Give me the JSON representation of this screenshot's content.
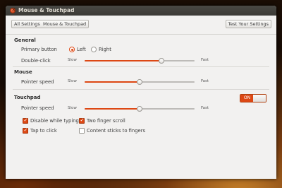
{
  "window": {
    "title": "Mouse & Touchpad"
  },
  "toolbar": {
    "crumbs": [
      "All Settings",
      "Mouse & Touchpad"
    ],
    "test_button": "Test Your Settings"
  },
  "general": {
    "title": "General",
    "primary_button_label": "Primary button",
    "left_label": "Left",
    "right_label": "Right",
    "primary_selected": "Left",
    "double_click_label": "Double-click",
    "double_click_min": "Slow",
    "double_click_max": "Fast",
    "double_click_value": 0.7
  },
  "mouse": {
    "title": "Mouse",
    "pointer_speed_label": "Pointer speed",
    "speed_min": "Slow",
    "speed_max": "Fast",
    "speed_value": 0.5
  },
  "touchpad": {
    "title": "Touchpad",
    "toggle_label": "ON",
    "enabled": true,
    "pointer_speed_label": "Pointer speed",
    "speed_min": "Slow",
    "speed_max": "Fast",
    "speed_value": 0.5,
    "options": [
      {
        "label": "Disable while typing",
        "checked": true
      },
      {
        "label": "Two finger scroll",
        "checked": true
      },
      {
        "label": "Tap to click",
        "checked": true
      },
      {
        "label": "Content sticks to fingers",
        "checked": false
      }
    ]
  },
  "colors": {
    "accent": "#dd4814",
    "titlebar": "#3c3b37",
    "window_bg": "#f2f1f0"
  }
}
